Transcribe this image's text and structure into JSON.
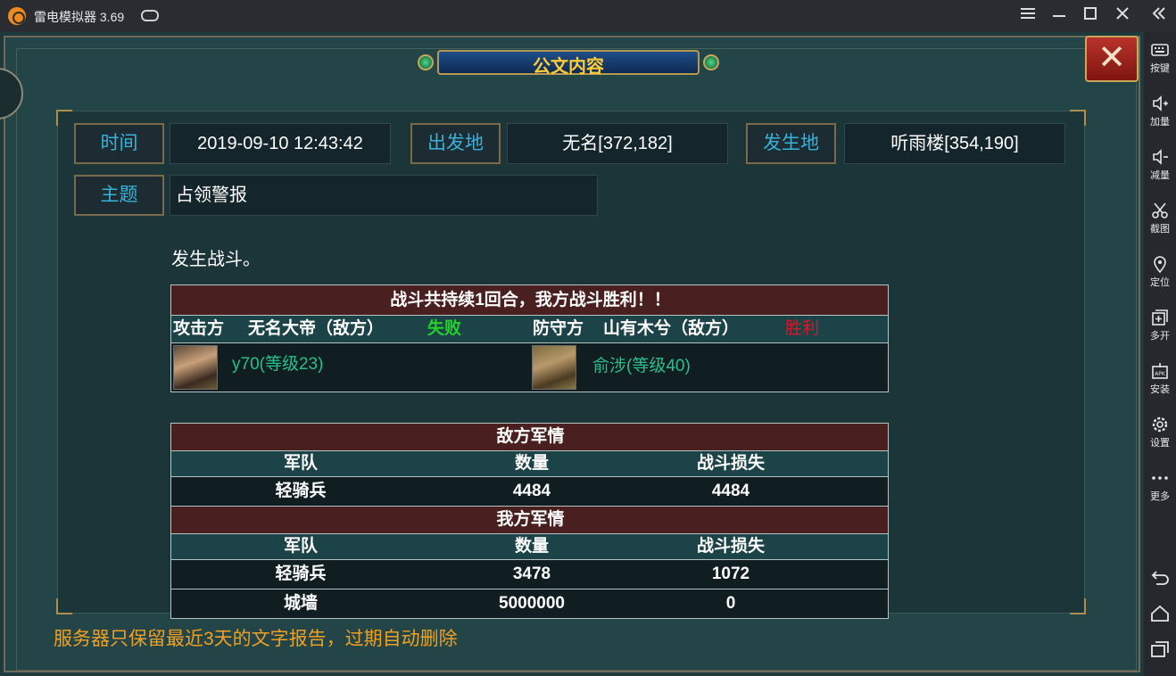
{
  "app": {
    "title": "雷电模拟器 3.69"
  },
  "titlebar": {
    "menu_icon": "menu-icon",
    "min_icon": "minimize-icon",
    "max_icon": "maximize-icon",
    "close_icon": "close-icon",
    "collapse_icon": "double-chevron-left-icon"
  },
  "sidebar": {
    "items": [
      {
        "label": "按键",
        "icon": "keyboard-icon"
      },
      {
        "label": "加量",
        "icon": "volume-up-icon"
      },
      {
        "label": "减量",
        "icon": "volume-down-icon"
      },
      {
        "label": "截图",
        "icon": "scissors-icon"
      },
      {
        "label": "定位",
        "icon": "location-pin-icon"
      },
      {
        "label": "多开",
        "icon": "multi-window-icon"
      },
      {
        "label": "安装",
        "icon": "apk-icon"
      },
      {
        "label": "设置",
        "icon": "gear-icon"
      },
      {
        "label": "更多",
        "icon": "more-icon"
      }
    ],
    "nav": [
      "back-icon",
      "home-icon",
      "recent-apps-icon"
    ]
  },
  "dialog": {
    "title": "公文内容",
    "close_glyph": "✕",
    "fields": {
      "time_label": "时间",
      "time_value": "2019-09-10  12:43:42",
      "origin_label": "出发地",
      "origin_value": "无名[372,182]",
      "location_label": "发生地",
      "location_value": "听雨楼[354,190]",
      "subject_label": "主题",
      "subject_value": "占领警报"
    },
    "body": "发生战斗。",
    "battle": {
      "summary": "战斗共持续1回合，我方战斗胜利！！",
      "attacker_label": "攻击方",
      "attacker_name": "无名大帝（敌方）",
      "attacker_result": "失败",
      "defender_label": "防守方",
      "defender_name": "山有木兮（敌方）",
      "defender_result": "胜利",
      "attacker_general": "y70(等级23)",
      "defender_general": "俞涉(等级40)",
      "enemy_section": "敌方军情",
      "own_section": "我方军情",
      "columns": [
        "军队",
        "数量",
        "战斗损失"
      ],
      "enemy_rows": [
        [
          "轻骑兵",
          "4484",
          "4484"
        ]
      ],
      "own_rows": [
        [
          "轻骑兵",
          "3478",
          "1072"
        ],
        [
          "城墙",
          "5000000",
          "0"
        ]
      ]
    },
    "footer": "服务器只保留最近3天的文字报告，过期自动删除"
  }
}
